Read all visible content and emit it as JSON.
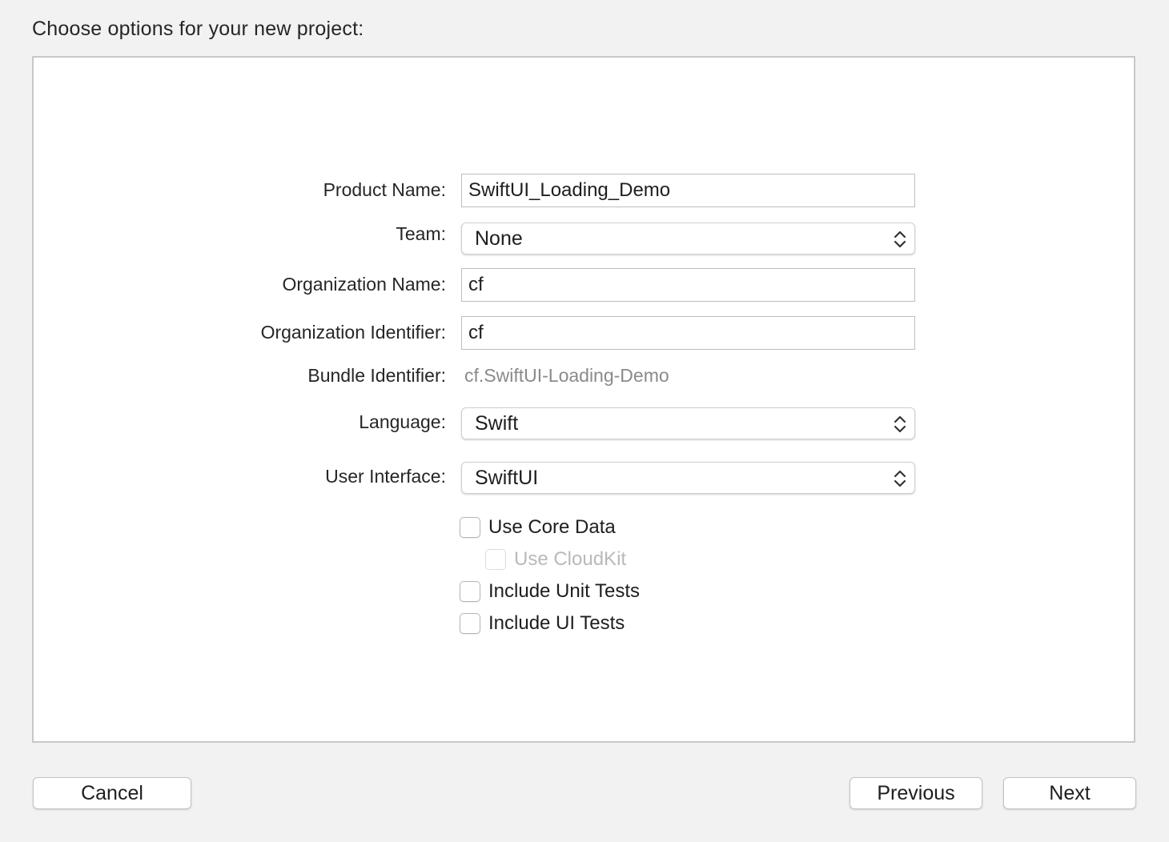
{
  "heading": "Choose options for your new project:",
  "form": {
    "product_name": {
      "label": "Product Name:",
      "value": "SwiftUI_Loading_Demo"
    },
    "team": {
      "label": "Team:",
      "selected": "None"
    },
    "organization_name": {
      "label": "Organization Name:",
      "value": "cf"
    },
    "organization_identifier": {
      "label": "Organization Identifier:",
      "value": "cf"
    },
    "bundle_identifier": {
      "label": "Bundle Identifier:",
      "value": "cf.SwiftUI-Loading-Demo"
    },
    "language": {
      "label": "Language:",
      "selected": "Swift"
    },
    "user_interface": {
      "label": "User Interface:",
      "selected": "SwiftUI"
    }
  },
  "options": {
    "use_core_data": {
      "label": "Use Core Data",
      "checked": false,
      "enabled": true
    },
    "use_cloudkit": {
      "label": "Use CloudKit",
      "checked": false,
      "enabled": false
    },
    "include_unit_tests": {
      "label": "Include Unit Tests",
      "checked": false,
      "enabled": true
    },
    "include_ui_tests": {
      "label": "Include UI Tests",
      "checked": false,
      "enabled": true
    }
  },
  "buttons": {
    "cancel": "Cancel",
    "previous": "Previous",
    "next": "Next"
  },
  "icons": {
    "popup_indicator": "chevron-up-down-icon"
  }
}
